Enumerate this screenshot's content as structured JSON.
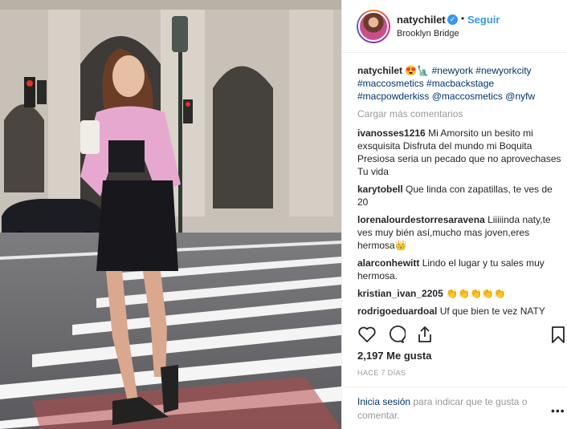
{
  "post": {
    "username": "natychilet",
    "follow_label": "Seguir",
    "location": "Brooklyn Bridge",
    "caption_emojis": "😍🗽",
    "caption_tags": [
      "#newyork",
      "#newyorkcity",
      "#maccosmetics",
      "#macbackstage",
      "#macpowderkiss",
      "@maccosmetics",
      "@nyfw"
    ],
    "load_more": "Cargar más comentarios",
    "comments": [
      {
        "user": "ivanosses1216",
        "text": "Mi Amorsito un besito mi exsquisita Disfruta del mundo mi Boquita Presiosa seria un pecado que no aprovechases Tu vida"
      },
      {
        "user": "karytobell",
        "text": "Que linda con zapatillas, te ves de 20"
      },
      {
        "user": "lorenalourdestorresaravena",
        "text": "Liiiiinda naty,te ves muy bién así,mucho mas joven,eres hermosa👑"
      },
      {
        "user": "alarconhewitt",
        "text": "Lindo el lugar y tu sales muy hermosa."
      },
      {
        "user": "kristian_ivan_2205",
        "text": "👏👏👏👏👏"
      },
      {
        "user": "rodrigoeduardoal",
        "text": "Uf que bien te vez NATY"
      }
    ],
    "likes": "2,197 Me gusta",
    "time": "HACE 7 DÍAS",
    "login_link": "Inicia sesión",
    "login_text": " para indicar que te gusta o comentar.",
    "more": "•••",
    "verified_glyph": "✓",
    "separator": "•"
  },
  "icons": [
    "heart-icon",
    "comment-icon",
    "share-icon",
    "bookmark-icon"
  ]
}
